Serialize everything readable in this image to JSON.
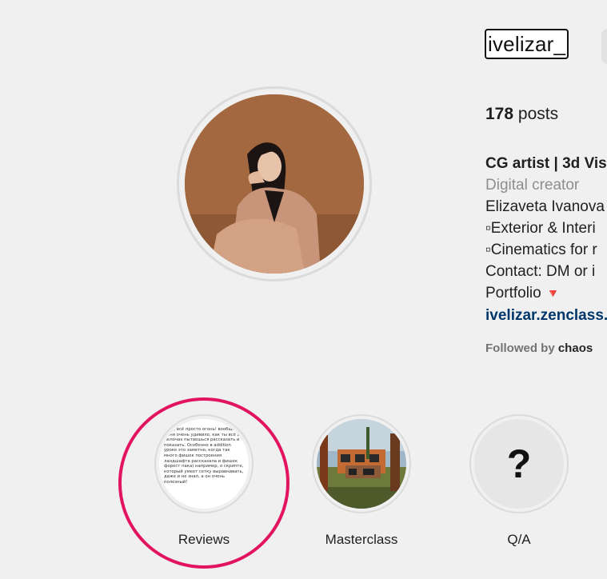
{
  "profile": {
    "username": "ivelizar_",
    "posts_count": "178",
    "posts_label": "posts",
    "bio": {
      "name": "CG artist | 3d Vis",
      "category": "Digital creator",
      "line1": "Elizaveta Ivanova",
      "line2": "▫Exterior & Interi",
      "line3": "▫Cinematics for r",
      "line4": "Contact: DM or i",
      "portfolio_label": "Portfolio",
      "portfolio_marker": "🔻",
      "link": "ivelizar.zenclass."
    },
    "followed_by_label": "Followed by",
    "followed_by_user": "chaos"
  },
  "highlights": [
    {
      "label": "Reviews",
      "preview_text": "…ом, всё просто огонь! вообще, меня очень удивило, как ты всё в мелочах пытаешься рассказать и показать. Особенно в addition уроке это заметно, когда так много фишек построения ландшафта рассказала и фишек форест пака) например, о скрипте, который умеет сетку выравнивать, даже и не знал, а он очень полезный!"
    },
    {
      "label": "Masterclass"
    },
    {
      "label": "Q/A",
      "icon_glyph": "?"
    }
  ],
  "colors": {
    "focus_ring": "#e3145f",
    "link": "#00376b",
    "muted": "#8e8e8e",
    "background": "#f0f0f0"
  }
}
